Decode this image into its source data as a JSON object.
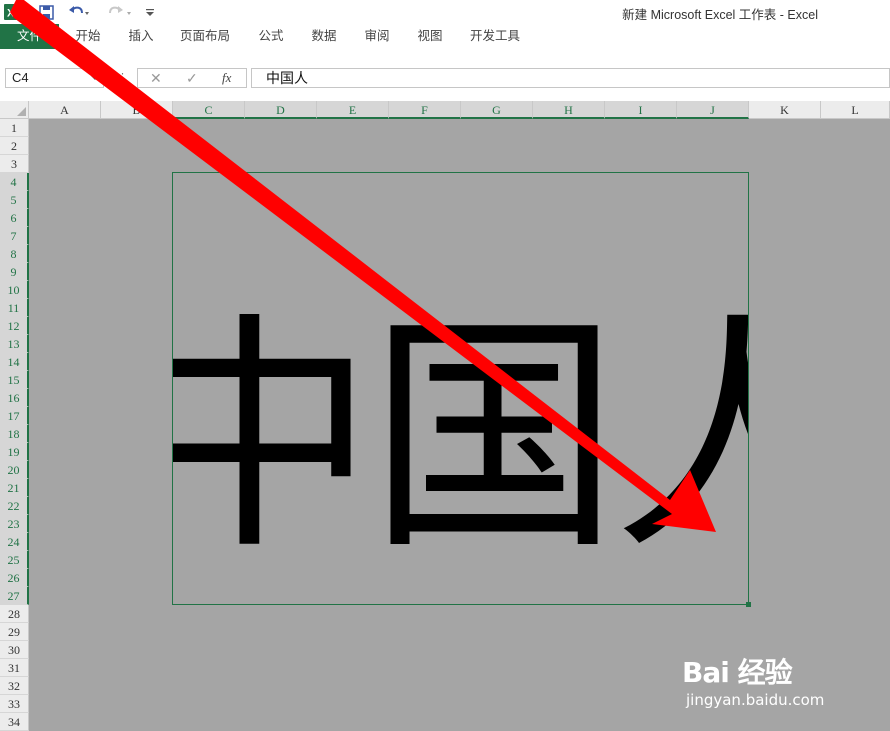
{
  "window": {
    "title": "新建 Microsoft Excel 工作表 - Excel",
    "quick_access": [
      "excel-logo-icon",
      "save-icon",
      "undo-icon",
      "redo-icon",
      "customize-icon"
    ]
  },
  "ribbon": {
    "tabs": [
      "文件",
      "开始",
      "插入",
      "页面布局",
      "公式",
      "数据",
      "审阅",
      "视图",
      "开发工具"
    ]
  },
  "formula_bar": {
    "name_box": "C4",
    "separator": "⋮",
    "cancel_glyph": "✕",
    "enter_glyph": "✓",
    "fx_glyph": "fx",
    "value": "中国人"
  },
  "sheet": {
    "columns": [
      "A",
      "B",
      "C",
      "D",
      "E",
      "F",
      "G",
      "H",
      "I",
      "J",
      "K",
      "L"
    ],
    "selected_columns": [
      "C",
      "D",
      "E",
      "F",
      "G",
      "H",
      "I",
      "J"
    ],
    "rows": [
      "1",
      "2",
      "3",
      "4",
      "5",
      "6",
      "7",
      "8",
      "9",
      "10",
      "11",
      "12",
      "13",
      "14",
      "15",
      "16",
      "17",
      "18",
      "19",
      "20",
      "21",
      "22",
      "23",
      "24",
      "25",
      "26",
      "27",
      "28",
      "29",
      "30",
      "31",
      "32",
      "33",
      "34"
    ],
    "selected_rows": [
      "4",
      "5",
      "6",
      "7",
      "8",
      "9",
      "10",
      "11",
      "12",
      "13",
      "14",
      "15",
      "16",
      "17",
      "18",
      "19",
      "20",
      "21",
      "22",
      "23",
      "24",
      "25",
      "26",
      "27"
    ],
    "picture_text": "中国人"
  },
  "overlay": {
    "arrow_color": "#ff0000"
  },
  "watermark": {
    "brand": "Bai 经验",
    "url": "jingyan.baidu.com"
  },
  "colors": {
    "accent": "#217346",
    "sheet_background": "#a5a5a5"
  }
}
